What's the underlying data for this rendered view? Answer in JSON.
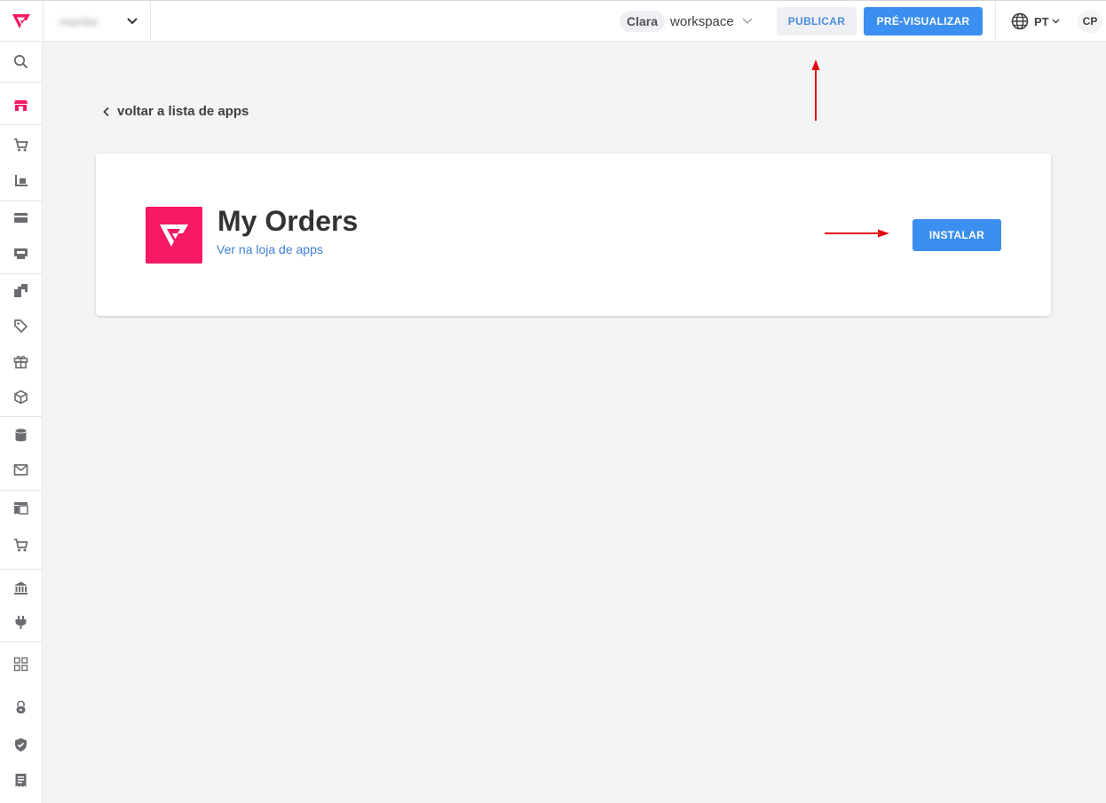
{
  "header": {
    "account_name": "mambo",
    "workspace_user": "Clara",
    "workspace_name": "workspace",
    "publish_label": "PUBLICAR",
    "preview_label": "PRÉ-VISUALIZAR",
    "language": "PT",
    "user_initials": "CP"
  },
  "sidebar": {
    "icons": [
      "search-icon",
      "store-icon",
      "cart-icon",
      "shipping-icon",
      "payment-card-icon",
      "register-icon",
      "catalog-icon",
      "tag-icon",
      "gift-icon",
      "box-icon",
      "database-icon",
      "mail-icon",
      "layout-icon",
      "promo-cart-icon",
      "bank-icon",
      "plug-icon",
      "apps-grid-icon",
      "lock-icon",
      "shield-icon",
      "receipt-icon"
    ],
    "active_icon": "store-icon"
  },
  "main": {
    "back_label": "voltar a lista de apps",
    "app": {
      "name": "My Orders",
      "store_link": "Ver na loja de apps",
      "install_label": "INSTALAR"
    }
  },
  "colors": {
    "brand": "#f71963",
    "primary": "#3b8ff0",
    "annotation_arrow": "#e30613"
  }
}
